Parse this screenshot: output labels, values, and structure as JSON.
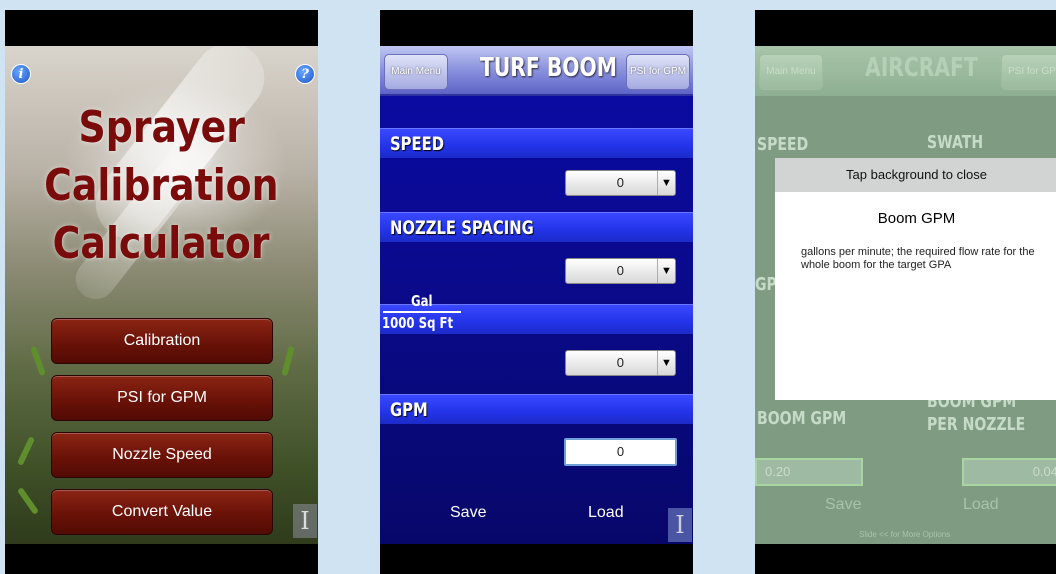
{
  "phone1": {
    "title_lines": [
      "Sprayer",
      "Calibration",
      "Calculator"
    ],
    "info_icon": "info-icon",
    "help_icon": "help-icon",
    "info_glyph": "i",
    "help_glyph": "?",
    "buttons": [
      {
        "label": "Calibration"
      },
      {
        "label": "PSI for GPM"
      },
      {
        "label": "Nozzle Speed"
      },
      {
        "label": "Convert Value"
      }
    ],
    "corner_tag": "I"
  },
  "phone2": {
    "header": {
      "left_button": "Main Menu",
      "title": "TURF BOOM",
      "right_button": "PSI for GPM"
    },
    "sections": [
      {
        "label": "SPEED",
        "value": "0"
      },
      {
        "label": "NOZZLE SPACING",
        "value": "0"
      },
      {
        "label_top": "Gal",
        "label_bottom": "1000 Sq Ft",
        "value": "0"
      },
      {
        "label": "GPM",
        "value": "0"
      }
    ],
    "dropdown_arrow": "▼",
    "footer": {
      "save": "Save",
      "load": "Load"
    },
    "corner_tag": "I"
  },
  "phone3": {
    "header": {
      "left_button": "Main Menu",
      "title": "AIRCRAFT",
      "right_button": "PSI for GP"
    },
    "labels": {
      "speed": "SPEED",
      "swath": "SWATH",
      "gp_partial": "GP",
      "boom_gpm": "BOOM GPM",
      "boom_gpm_per_nozzle_1": "BOOM GPM",
      "boom_gpm_per_nozzle_2": "PER NOZZLE"
    },
    "values": {
      "boom_gpm": "0.20",
      "per_nozzle": "0.04"
    },
    "footer": {
      "save": "Save",
      "load": "Load",
      "hint": "Slide << for More Options"
    },
    "tooltip": {
      "header": "Tap background to close",
      "title": "Boom GPM",
      "text": "gallons per minute; the required flow rate for the whole boom for the target GPA"
    }
  },
  "colors": {
    "background": "#cfe3f3",
    "maroon_title": "#7a0b0b",
    "button_maroon": "#6a1208",
    "blue_screen": "#0a0a8a",
    "section_blue": "#2233e8"
  }
}
